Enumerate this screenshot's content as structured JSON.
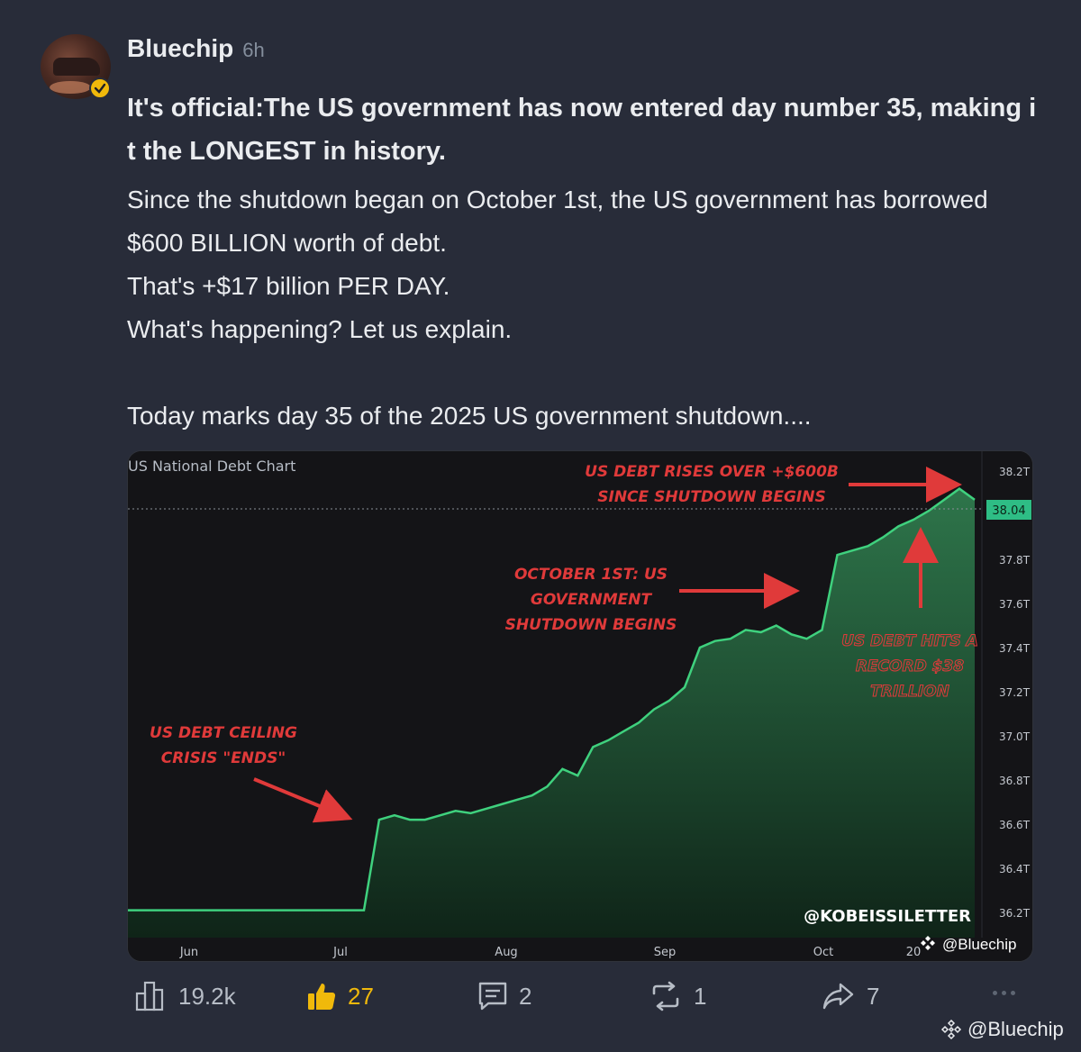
{
  "post": {
    "author": "Bluechip",
    "time": "6h",
    "headline": "It's official:The US government has now entered day number 35, making it the LONGEST in history.",
    "paragraphs": [
      "Since the shutdown began on October 1st, the US government has borrowed $600 BILLION worth of debt.",
      "That's +$17 billion PER DAY.",
      "What's happening? Let us explain."
    ],
    "teaser": "Today marks day 35 of the 2025 US government shutdown...."
  },
  "chart_image": {
    "title": "US National Debt Chart",
    "price_current": "38.04",
    "watermark": "@KOBEISSILETTER",
    "x_tick_tail": "20",
    "annotations": {
      "top_line1": "US DEBT RISES OVER +$600B",
      "top_line2": "SINCE SHUTDOWN BEGINS",
      "oct_line1": "OCTOBER 1ST: US",
      "oct_line2": "GOVERNMENT",
      "oct_line3": "SHUTDOWN BEGINS",
      "record_line1": "US DEBT HITS A",
      "record_line2": "RECORD $38",
      "record_line3": "TRILLION",
      "ceiling_line1": "US DEBT CEILING",
      "ceiling_line2": "CRISIS \"ENDS\""
    },
    "bluechip_tag": "@Bluechip"
  },
  "chart_data": {
    "type": "area",
    "title": "US National Debt Chart",
    "xlabel": "",
    "ylabel": "",
    "x_ticks": [
      "Jun",
      "Jul",
      "Aug",
      "Sep",
      "Oct",
      "20"
    ],
    "y_ticks": [
      "38.2T",
      "38.0T",
      "37.8T",
      "37.6T",
      "37.4T",
      "37.2T",
      "37.0T",
      "36.8T",
      "36.6T",
      "36.4T",
      "36.2T"
    ],
    "ylim": [
      36.2,
      38.2
    ],
    "series": [
      {
        "values": [
          36.21,
          36.21,
          36.21,
          36.21,
          36.21,
          36.21,
          36.21,
          36.21,
          36.21,
          36.21,
          36.21,
          36.21,
          36.21,
          36.21,
          36.21,
          36.21,
          36.21,
          36.21,
          36.21,
          36.21,
          36.21,
          36.21,
          36.21,
          36.21,
          36.21,
          36.21,
          36.21,
          36.21,
          36.21,
          36.21,
          36.21,
          36.21,
          36.21,
          36.21,
          36.21,
          36.21,
          36.21,
          36.21,
          36.21,
          36.21,
          36.21,
          36.21,
          36.21,
          36.21,
          36.21,
          36.21,
          36.21,
          36.21,
          36.21,
          36.21,
          36.21,
          36.21,
          36.21,
          36.21,
          36.21,
          36.21,
          36.21,
          36.21,
          36.21,
          36.21,
          36.21,
          36.21,
          36.21,
          36.21,
          36.21,
          36.21,
          36.21,
          36.21,
          36.21,
          36.21,
          36.21,
          36.21,
          36.21,
          36.21,
          36.21,
          36.21,
          36.21,
          36.21,
          36.21,
          36.21,
          36.21,
          36.21,
          36.21,
          36.21,
          36.21,
          36.21,
          36.21,
          36.21,
          36.21,
          36.21,
          36.21,
          36.21,
          36.21,
          36.21,
          36.21,
          36.21,
          36.21,
          36.21,
          36.21,
          36.21,
          36.21,
          36.21,
          36.21,
          36.21,
          36.21,
          36.21,
          36.21,
          36.21,
          36.21,
          36.21,
          36.21,
          36.21,
          36.21,
          36.21,
          36.21,
          36.21,
          36.21,
          36.21,
          36.21,
          36.21,
          36.21,
          36.21,
          36.21,
          36.21,
          36.21,
          36.21,
          36.21,
          36.21,
          36.21,
          36.21,
          36.21,
          36.21,
          36.21,
          36.21,
          36.21,
          36.21,
          36.21,
          36.21,
          36.21,
          36.21,
          36.21,
          36.21,
          36.21,
          36.21,
          36.21,
          36.21,
          36.21,
          36.21,
          36.21,
          36.21,
          36.21,
          36.21,
          36.21,
          36.21,
          36.21,
          36.21,
          36.21,
          36.21,
          36.21,
          36.21,
          36.21,
          36.21,
          36.21,
          36.21,
          36.21,
          36.21,
          36.21,
          36.21,
          36.21,
          36.21,
          36.21,
          36.21,
          36.21,
          36.21,
          36.21,
          36.21,
          36.21,
          36.21,
          36.21,
          36.21,
          36.21,
          36.21,
          36.21,
          36.21,
          36.21,
          36.21,
          36.21,
          36.21,
          36.21,
          36.21,
          36.21,
          36.21,
          36.21,
          36.21,
          36.21,
          36.21,
          36.21,
          36.21,
          36.21,
          36.21,
          36.21,
          36.21,
          36.21,
          36.21,
          36.21,
          36.21,
          36.21,
          36.21,
          36.21,
          36.21,
          36.21,
          36.21,
          36.21,
          36.21,
          36.21,
          36.21,
          36.21,
          36.21,
          36.21,
          36.21,
          36.21,
          36.21,
          36.21,
          36.21,
          36.21,
          36.21,
          36.21,
          36.21,
          36.21,
          36.21,
          36.21,
          36.21,
          36.21,
          36.21,
          36.21,
          36.21,
          36.21,
          36.21,
          36.21,
          36.21,
          36.21,
          36.21,
          36.21,
          36.21,
          36.21,
          36.21,
          36.21,
          36.21,
          36.21,
          36.21,
          36.21,
          36.21,
          36.21,
          36.21,
          36.21,
          36.21,
          36.21,
          36.21,
          36.21,
          36.21,
          36.21,
          36.21
        ]
      }
    ],
    "points": [
      [
        "Jun",
        36.21
      ],
      [
        "Jun",
        36.21
      ],
      [
        "Jul",
        36.21
      ],
      [
        "Jul",
        36.62
      ],
      [
        "Jul",
        36.64
      ],
      [
        "Jul",
        36.62
      ],
      [
        "Jul",
        36.62
      ],
      [
        "Jul",
        36.64
      ],
      [
        "Jul",
        36.66
      ],
      [
        "Jul",
        36.65
      ],
      [
        "Jul",
        36.67
      ],
      [
        "Jul",
        36.69
      ],
      [
        "Aug",
        36.71
      ],
      [
        "Aug",
        36.73
      ],
      [
        "Aug",
        36.77
      ],
      [
        "Aug",
        36.85
      ],
      [
        "Aug",
        36.82
      ],
      [
        "Aug",
        36.95
      ],
      [
        "Aug",
        36.98
      ],
      [
        "Aug",
        37.02
      ],
      [
        "Aug",
        37.06
      ],
      [
        "Aug",
        37.12
      ],
      [
        "Aug",
        37.16
      ],
      [
        "Sep",
        37.22
      ],
      [
        "Sep",
        37.4
      ],
      [
        "Sep",
        37.43
      ],
      [
        "Sep",
        37.44
      ],
      [
        "Sep",
        37.48
      ],
      [
        "Sep",
        37.47
      ],
      [
        "Sep",
        37.5
      ],
      [
        "Sep",
        37.46
      ],
      [
        "Sep",
        37.44
      ],
      [
        "Sep",
        37.48
      ],
      [
        "Oct",
        37.82
      ],
      [
        "Oct",
        37.84
      ],
      [
        "Oct",
        37.86
      ],
      [
        "Oct",
        37.9
      ],
      [
        "Oct",
        37.95
      ],
      [
        "Oct",
        37.98
      ],
      [
        "Oct",
        38.02
      ],
      [
        "20",
        38.07
      ],
      [
        "20",
        38.12
      ],
      [
        "20",
        38.07
      ]
    ]
  },
  "actions": {
    "views": "19.2k",
    "likes": "27",
    "comments": "2",
    "reposts": "1",
    "shares": "7"
  },
  "watermark": "@Bluechip",
  "colors": {
    "background": "#282c39",
    "accent": "#f0b90b",
    "chart_green": "#2ebd85",
    "annotation_red": "#e03a3a"
  }
}
